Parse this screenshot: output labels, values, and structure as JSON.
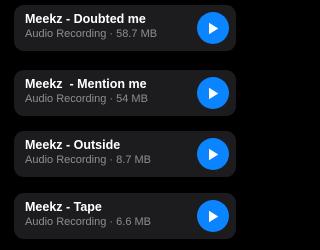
{
  "accent_color": "#0a84ff",
  "items": [
    {
      "title": "Meekz - Doubted me",
      "type": "Audio Recording",
      "separator": "·",
      "size": "58.7 MB",
      "icon": "play-icon"
    },
    {
      "title": "Meekz  - Mention me",
      "type": "Audio Recording",
      "separator": "·",
      "size": "54 MB",
      "icon": "play-icon"
    },
    {
      "title": "Meekz - Outside",
      "type": "Audio Recording",
      "separator": "·",
      "size": "8.7 MB",
      "icon": "play-icon"
    },
    {
      "title": "Meekz - Tape",
      "type": "Audio Recording",
      "separator": "·",
      "size": "6.6 MB",
      "icon": "play-icon"
    }
  ]
}
